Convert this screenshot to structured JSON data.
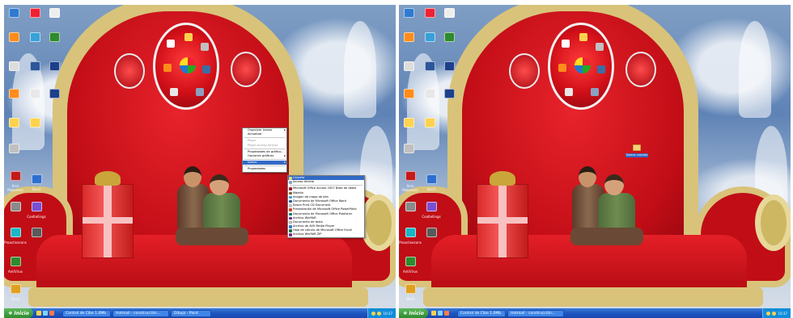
{
  "colors": {
    "taskbar": "#1f56c2",
    "start": "#2e8b2e",
    "menu_highlight": "#316ac5",
    "throne_red": "#c10d16",
    "throne_gold": "#d9c37a"
  },
  "desktop": {
    "icons": [
      {
        "label": "Arco Makorena",
        "icon": "app-icon",
        "color": "#c21b1b"
      },
      {
        "label": "Dvs3",
        "icon": "app-icon",
        "color": "#2d6fd0"
      },
      {
        "label": "Cooltellings",
        "icon": "app-icon",
        "color": "#7a4fd0"
      },
      {
        "label": "Proactivecons",
        "icon": "app-icon",
        "color": "#19b6c6"
      },
      {
        "label": "AntiVirus",
        "icon": "app-icon",
        "color": "#2e8b2e"
      },
      {
        "label": "Dvs3",
        "icon": "app-icon",
        "color": "#e0a020"
      }
    ]
  },
  "left_screen": {
    "context_menu": {
      "items": [
        {
          "label": "Organizar iconos",
          "state": "normal",
          "submenu": true
        },
        {
          "label": "Actualizar",
          "state": "normal",
          "submenu": false
        },
        {
          "label": "Pegar",
          "state": "disabled",
          "submenu": false
        },
        {
          "label": "Pegar acceso directo",
          "state": "disabled",
          "submenu": false
        },
        {
          "label": "Propiedades de gráfico...",
          "state": "normal",
          "submenu": false
        },
        {
          "label": "Opciones gráficas",
          "state": "normal",
          "submenu": true
        },
        {
          "label": "Nuevo",
          "state": "highlighted",
          "submenu": true
        },
        {
          "label": "Propiedades",
          "state": "normal",
          "submenu": false
        }
      ]
    },
    "submenu_nuevo": {
      "items": [
        {
          "label": "Carpeta",
          "state": "highlighted",
          "icon": "folder-icon",
          "color": "#f3d37a"
        },
        {
          "label": "Acceso directo",
          "state": "normal",
          "icon": "shortcut-icon",
          "color": "#8aa0c0"
        },
        {
          "label": "Microsoft Office Access 2007 Base de datos",
          "state": "normal",
          "icon": "access-icon",
          "color": "#a3192b"
        },
        {
          "label": "Maletín",
          "state": "normal",
          "icon": "briefcase-icon",
          "color": "#8b5a2b"
        },
        {
          "label": "Imagen de mapa de bits",
          "state": "normal",
          "icon": "bitmap-icon",
          "color": "#3aa0d8"
        },
        {
          "label": "Documento de Microsoft Office Word",
          "state": "normal",
          "icon": "word-icon",
          "color": "#2b579a"
        },
        {
          "label": "Epson Print CD Document",
          "state": "normal",
          "icon": "cd-icon",
          "color": "#c0c0c0"
        },
        {
          "label": "Presentación de Microsoft Office PowerPoint",
          "state": "normal",
          "icon": "powerpoint-icon",
          "color": "#d24726"
        },
        {
          "label": "Documento de Microsoft Office Publisher",
          "state": "normal",
          "icon": "publisher-icon",
          "color": "#077568"
        },
        {
          "label": "Archivo WinRAR",
          "state": "normal",
          "icon": "winrar-icon",
          "color": "#7a2e8b"
        },
        {
          "label": "Documento de texto",
          "state": "normal",
          "icon": "text-icon",
          "color": "#e8e8e8"
        },
        {
          "label": "Archivo de AVS Media Player",
          "state": "normal",
          "icon": "media-icon",
          "color": "#2e7bd0"
        },
        {
          "label": "Hoja de cálculo de Microsoft Office Excel",
          "state": "normal",
          "icon": "excel-icon",
          "color": "#217346"
        },
        {
          "label": "Archivo WinRAR ZIP",
          "state": "normal",
          "icon": "zip-icon",
          "color": "#7a2e8b"
        }
      ]
    }
  },
  "right_screen": {
    "new_folder_label": "Nueva carpeta"
  },
  "taskbar": {
    "start_label": "Inicio",
    "left_tasks": [
      "Control de Cibe 1.0Mb",
      "Hotmail - construcción...",
      "Dibujo - Paint"
    ],
    "right_tasks": [
      "Control de Cibe 1.0Mb",
      "Hotmail - construcción..."
    ],
    "clock": "10:37"
  }
}
